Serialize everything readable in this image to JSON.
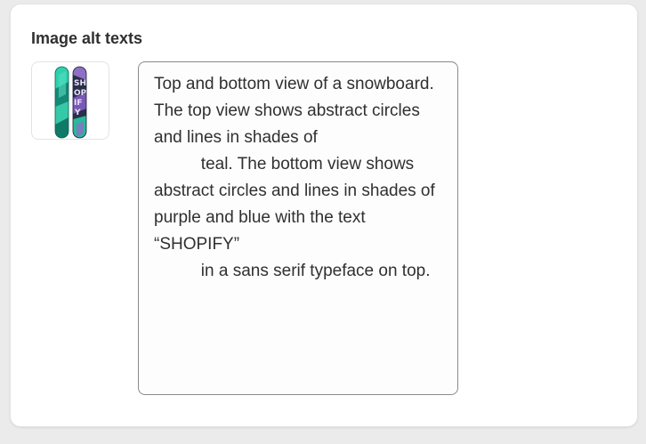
{
  "card": {
    "title": "Image alt texts"
  },
  "image": {
    "icon": "snowboard-thumbnail",
    "colors": {
      "teal": "#21b79a",
      "dark": "#2c2f4a",
      "purple": "#8f6fc5"
    }
  },
  "alt_text": {
    "value": "Top and bottom view of a snowboard. The top view shows abstract circles and lines in shades of\n          teal. The bottom view shows abstract circles and lines in shades of purple and blue with the text “SHOPIFY”\n          in a sans serif typeface on top."
  }
}
